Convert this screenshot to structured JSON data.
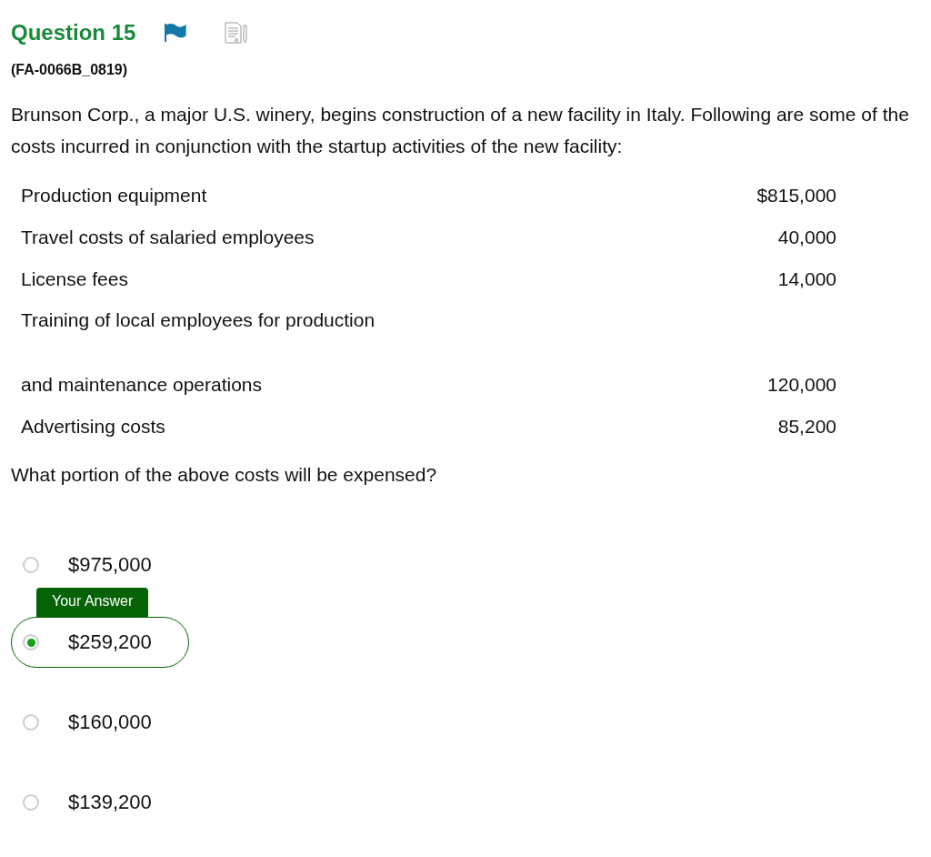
{
  "question": {
    "title": "Question 15",
    "flagged": true,
    "code": "(FA-0066B_0819)"
  },
  "stem": "Brunson Corp., a major U.S. winery, begins construction of a new facility in Italy. Following are some of the costs incurred in conjunction with the startup activities of the new facility:",
  "costs": [
    {
      "label": "Production equipment",
      "amount": "$815,000"
    },
    {
      "label": "Travel costs of salaried employees",
      "amount": "40,000"
    },
    {
      "label": "License fees",
      "amount": "14,000"
    },
    {
      "label": "Training of local employees for production"
    },
    {
      "label": "and maintenance operations",
      "amount": "120,000"
    },
    {
      "label": "Advertising costs",
      "amount": "85,200"
    }
  ],
  "prompt": "What portion of the above costs will be expensed?",
  "options": [
    {
      "label": "$975,000",
      "selected": false
    },
    {
      "label": "$259,200",
      "selected": true,
      "tag": "Your Answer"
    },
    {
      "label": "$160,000",
      "selected": false
    },
    {
      "label": "$139,200",
      "selected": false
    }
  ]
}
